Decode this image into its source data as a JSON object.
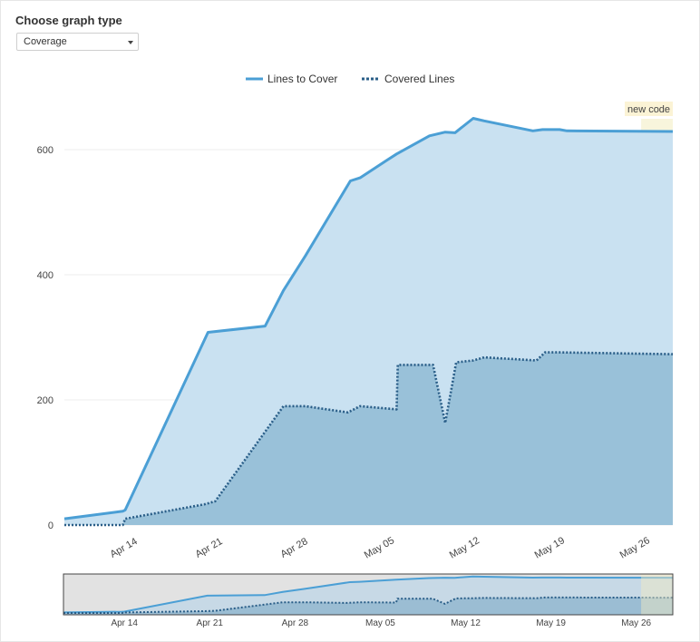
{
  "page": {
    "heading": "Choose graph type",
    "graph_type_select": {
      "value": "Coverage"
    }
  },
  "colors": {
    "lines_to_cover": "#4b9fd5",
    "covered_lines": "#2a5e88",
    "area_lines": "#c9e1f1",
    "area_covered": "#90bbd5",
    "new_code_band": "#f3ecc0",
    "new_code_label_bg": "#fbf3d5"
  },
  "chart_data": {
    "type": "area",
    "x_tick_labels": [
      "Apr 14",
      "Apr 21",
      "Apr 28",
      "May 05",
      "May 12",
      "May 19",
      "May 26"
    ],
    "y_ticks": [
      0,
      200,
      400,
      600
    ],
    "ylim": [
      0,
      630
    ],
    "xlim_days": [
      0,
      50
    ],
    "x_tick_days": [
      5,
      12,
      19,
      26,
      33,
      40,
      47
    ],
    "new_code": {
      "label": "new code",
      "start_day": 47.4,
      "end_day": 50
    },
    "series": [
      {
        "name": "Lines to Cover",
        "style": "solid",
        "points": [
          [
            0,
            10
          ],
          [
            4.8,
            22
          ],
          [
            5,
            24
          ],
          [
            11.8,
            308
          ],
          [
            16.5,
            318
          ],
          [
            18,
            375
          ],
          [
            19.8,
            430
          ],
          [
            23.5,
            550
          ],
          [
            24.3,
            555
          ],
          [
            26.5,
            583
          ],
          [
            27.3,
            593
          ],
          [
            30,
            622
          ],
          [
            31.3,
            628
          ],
          [
            32.1,
            627
          ],
          [
            33.6,
            650
          ],
          [
            34.5,
            646
          ],
          [
            38.5,
            630
          ],
          [
            39.3,
            632
          ],
          [
            40.7,
            632
          ],
          [
            41.3,
            630
          ],
          [
            50,
            629
          ]
        ]
      },
      {
        "name": "Covered Lines",
        "style": "dotted",
        "points": [
          [
            0,
            0
          ],
          [
            4.8,
            0
          ],
          [
            5,
            10
          ],
          [
            11.5,
            33
          ],
          [
            12.4,
            38
          ],
          [
            18,
            190
          ],
          [
            19.8,
            190
          ],
          [
            23.3,
            180
          ],
          [
            24.3,
            190
          ],
          [
            27.3,
            185
          ],
          [
            27.4,
            256
          ],
          [
            30.3,
            256
          ],
          [
            31.3,
            163
          ],
          [
            32.2,
            260
          ],
          [
            33.6,
            263
          ],
          [
            34.5,
            268
          ],
          [
            38.8,
            263
          ],
          [
            39.5,
            276
          ],
          [
            40.7,
            276
          ],
          [
            50,
            273
          ]
        ]
      }
    ]
  },
  "navigator": {
    "tick_labels": [
      "Apr 14",
      "Apr 21",
      "Apr 28",
      "May 05",
      "May 12",
      "May 19",
      "May 26"
    ]
  }
}
